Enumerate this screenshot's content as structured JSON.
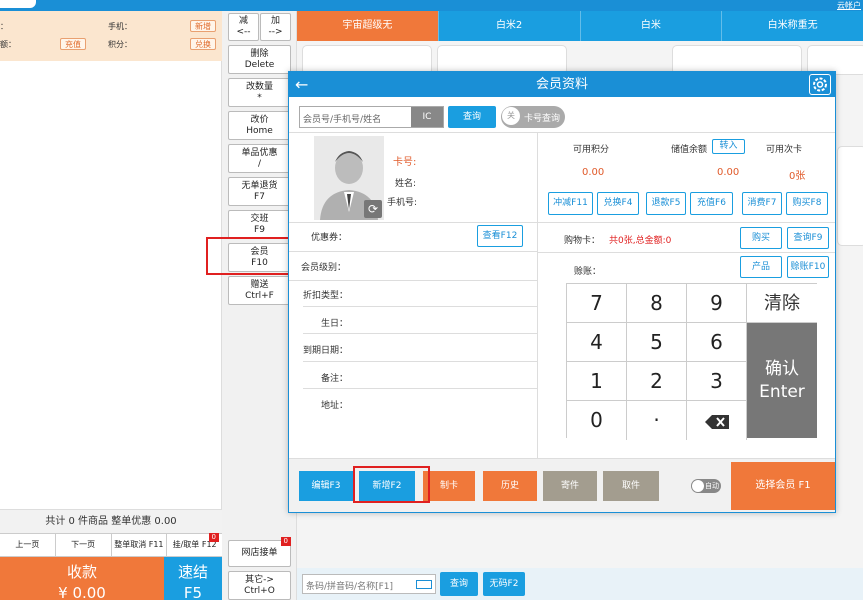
{
  "header": {
    "account": "云帐户"
  },
  "member_panel": {
    "phone_label": "手机：",
    "points_label": "积分：",
    "new_btn": "新增",
    "recharge_btn": "充值",
    "exchange_btn": "兑换",
    "row1_prefix": "：",
    "row2_prefix": "额："
  },
  "order_summary": "共计 0 件商品 整单优惠 0.00",
  "pager": [
    {
      "label": "上一页"
    },
    {
      "label": "下一页"
    },
    {
      "label": "整单取消 F11"
    },
    {
      "label": "挂/取单 F12",
      "badge": "0"
    }
  ],
  "pay": {
    "label": "收款",
    "amount": "¥ 0.00"
  },
  "quick_pay": {
    "label": "速结",
    "key": "F5"
  },
  "side_buttons": [
    {
      "l1": "减",
      "l2": "<--"
    },
    {
      "l1": "加",
      "l2": "-->"
    },
    {
      "l1": "删除",
      "l2": "Delete"
    },
    {
      "l1": "改数量",
      "l2": "*"
    },
    {
      "l1": "改价",
      "l2": "Home"
    },
    {
      "l1": "单品优惠",
      "l2": "/"
    },
    {
      "l1": "无单退货",
      "l2": "F7"
    },
    {
      "l1": "交班",
      "l2": "F9"
    },
    {
      "l1": "会员",
      "l2": "F10"
    },
    {
      "l1": "赠送",
      "l2": "Ctrl+F"
    },
    {
      "l1": "网店接单",
      "l2": "",
      "badge": "0"
    },
    {
      "l1": "其它->",
      "l2": "Ctrl+O"
    }
  ],
  "category_tabs": [
    "宇宙超级无",
    "白米2",
    "白米",
    "白米称重无"
  ],
  "bottom_search": {
    "placeholder": "条码/拼音码/名称[F1]",
    "search_btn": "查询",
    "nocode_btn": "无码F2"
  },
  "modal": {
    "title": "会员资料",
    "search_placeholder": "会员号/手机号/姓名",
    "ic_label": "IC",
    "query_btn": "查询",
    "toggle_off": "关",
    "card_query": "卡号查询",
    "card_no_label": "卡号:",
    "name_label": "姓名:",
    "phone_label": "手机号:",
    "available_points_label": "可用积分",
    "stored_balance_label": "储值余额",
    "transfer_btn": "转入",
    "available_times_label": "可用次卡",
    "points_value": "0.00",
    "balance_value": "0.00",
    "times_value": "0张",
    "action_buttons": [
      "冲减F11",
      "兑换F4",
      "退款F5",
      "充值F6",
      "消费F7",
      "购买F8"
    ],
    "coupon_label": "优惠券：",
    "view_btn": "查看F12",
    "level_label": "会员级别：",
    "discount_label": "折扣类型：",
    "birthday_label": "生日：",
    "expire_label": "到期日期：",
    "remark_label": "备注：",
    "address_label": "地址：",
    "shopping_card_label": "购物卡：",
    "shopping_card_value": "共0张,总金额:0",
    "buy_btn": "购买",
    "query_f9_btn": "查询F9",
    "credit_label": "赊账：",
    "product_btn": "产品",
    "credit_f10_btn": "赊账F10",
    "keypad": [
      "7",
      "8",
      "9",
      "4",
      "5",
      "6",
      "1",
      "2",
      "3",
      "0",
      "·"
    ],
    "clear_key": "清除",
    "confirm_key": "确认",
    "enter_key": "Enter",
    "footer_buttons": [
      {
        "label": "编辑F3",
        "color": "#1a9ee0"
      },
      {
        "label": "新增F2",
        "color": "#1a9ee0"
      },
      {
        "label": "制卡",
        "color": "#f0783a"
      },
      {
        "label": "历史",
        "color": "#f0783a"
      },
      {
        "label": "寄件",
        "color": "#a39d8f"
      },
      {
        "label": "取件",
        "color": "#a39d8f"
      }
    ],
    "auto_toggle": "自动",
    "select_member": "选择会员 F1"
  }
}
